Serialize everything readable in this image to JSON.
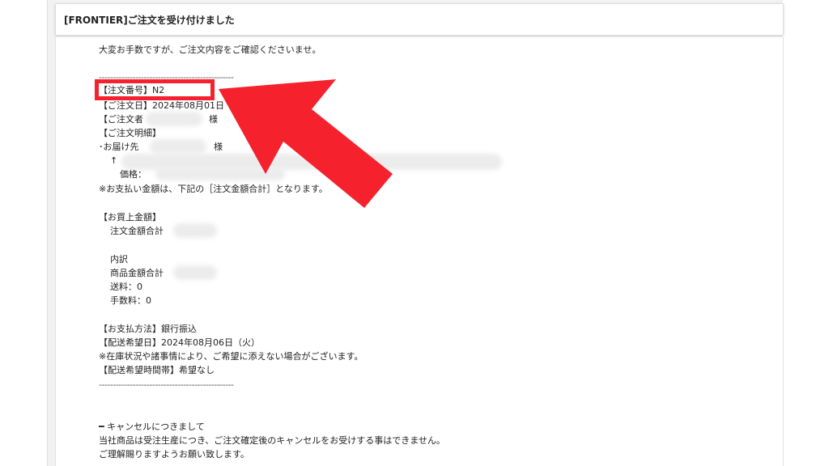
{
  "email": {
    "subject": "[FRONTIER]ご注文を受け付けました",
    "intro": "大変お手数ですが、ご注文内容をご確認くださいませ。",
    "divider": "------------------------------------------------",
    "order_number_label": "【注文番号】N2",
    "order_date_label": "【ご注文日】2024年08月01日",
    "orderer_label": "【ご注文者",
    "honorific": "様",
    "detail_label": "【ご注文明細】",
    "delivery_label": "･お届け先",
    "item_marker": "↑",
    "price_label": "価格：",
    "payment_note": "※お支払い金額は、下記の［注文金額合計］となります。",
    "purchase_amount_label": "【お買上金額】",
    "order_total_label": "注文金額合計",
    "breakdown_label": "内訳",
    "product_total_label": "商品金額合計",
    "shipping": "送料：0",
    "fee": "手数料：0",
    "payment_method": "【お支払方法】銀行振込",
    "delivery_date": "【配送希望日】2024年08月06日（火）",
    "stock_note": "※在庫状況や諸事情により、ご希望に添えない場合がございます。",
    "delivery_time": "【配送希望時間帯】希望なし",
    "cancel_heading": "━ キャンセルにつきまして",
    "cancel_text": "当社商品は受注生産につき、ご注文確定後のキャンセルをお受けする事はできません。",
    "cancel_thanks": "ご理解賜りますようお願い致します。"
  },
  "annotation": {
    "highlight_color": "#f5222d",
    "arrow_color": "#f5222d"
  }
}
